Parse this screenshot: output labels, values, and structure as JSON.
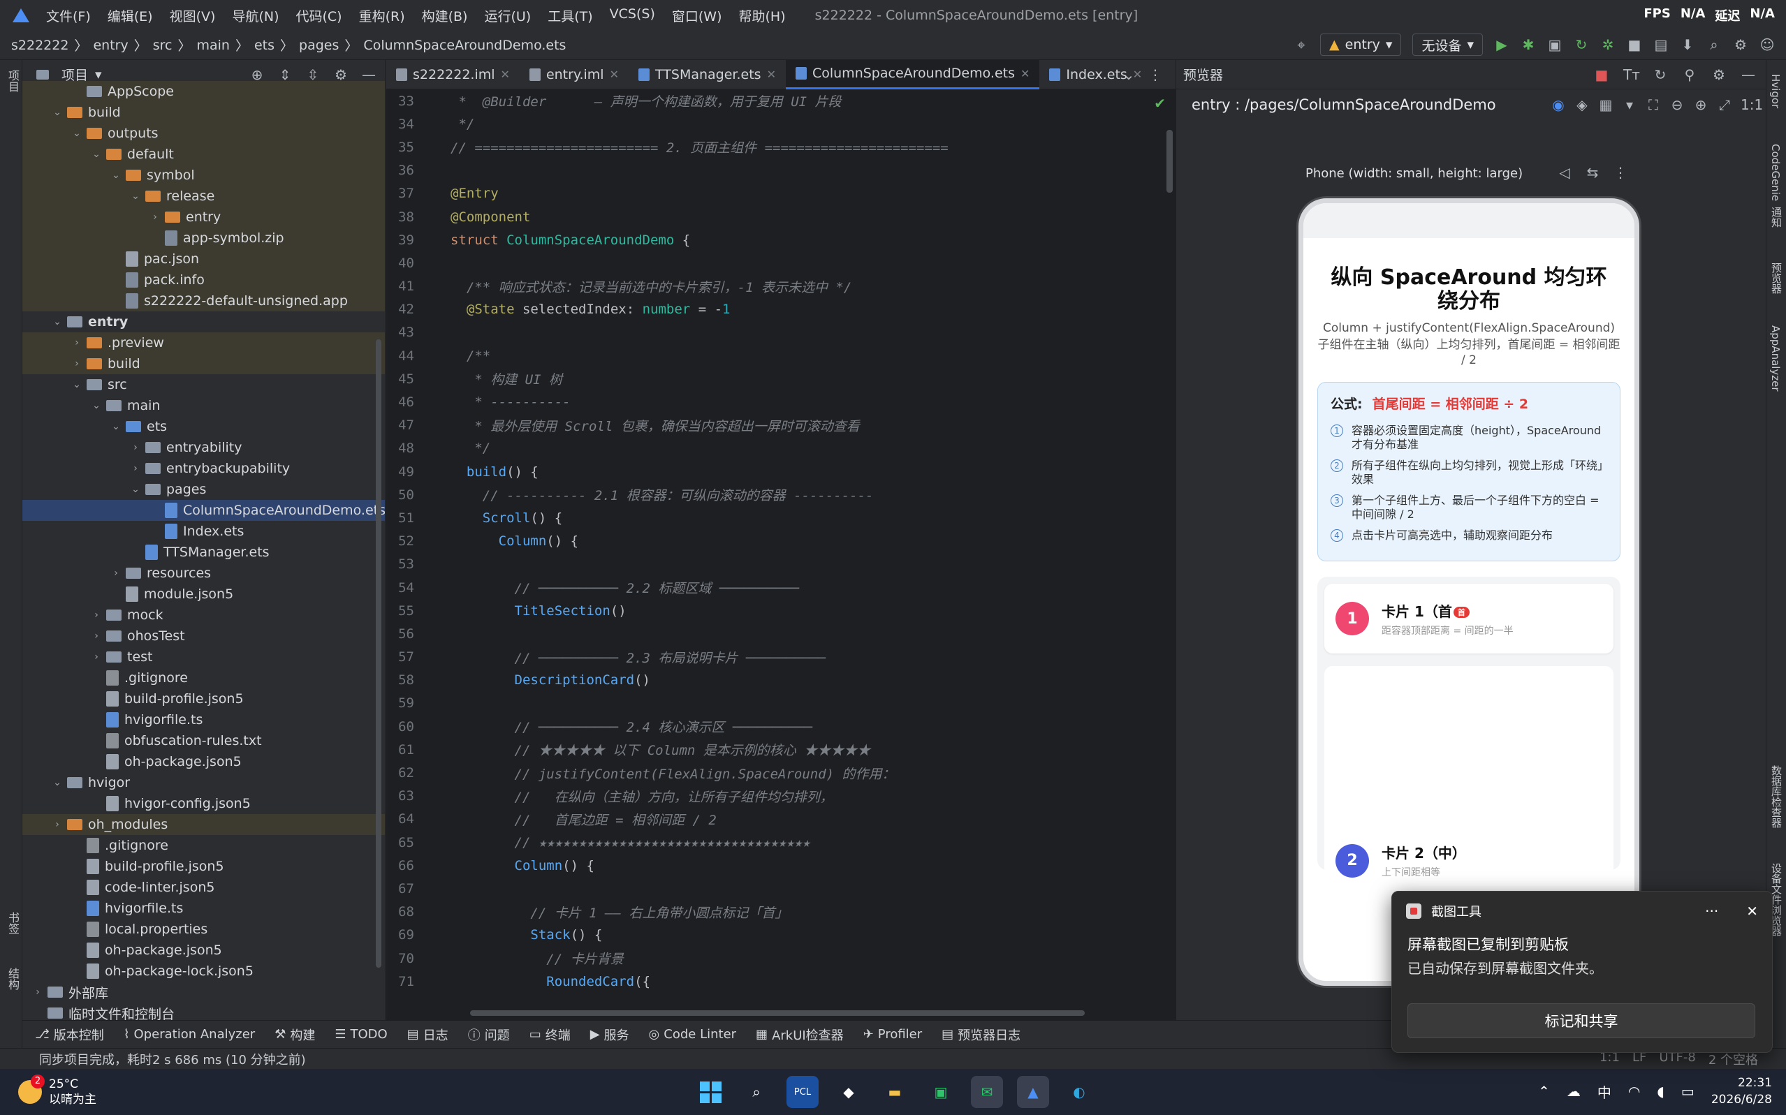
{
  "menubar": {
    "items": [
      "文件(F)",
      "编辑(E)",
      "视图(V)",
      "导航(N)",
      "代码(C)",
      "重构(R)",
      "构建(B)",
      "运行(U)",
      "工具(T)",
      "VCS(S)",
      "窗口(W)",
      "帮助(H)"
    ],
    "window_title": "s222222 - ColumnSpaceAroundDemo.ets [entry]",
    "fps_label": "FPS",
    "fps_value": "N/A",
    "delay_label": "延迟",
    "delay_value": "N/A"
  },
  "breadcrumb": [
    "s222222",
    "entry",
    "src",
    "main",
    "ets",
    "pages",
    "ColumnSpaceAroundDemo.ets"
  ],
  "run": {
    "module": "entry",
    "device": "无设备"
  },
  "leftstrip": {
    "project": "项目",
    "bookmarks": "书签",
    "structure": "结构"
  },
  "project": {
    "title": "项目",
    "tree": [
      {
        "d": 2,
        "t": "AppScope",
        "k": "fold",
        "a": "",
        "s": "ex"
      },
      {
        "d": 1,
        "t": "build",
        "k": "fold or",
        "a": "v",
        "s": "ex"
      },
      {
        "d": 2,
        "t": "outputs",
        "k": "fold or",
        "a": "v",
        "s": "ex"
      },
      {
        "d": 3,
        "t": "default",
        "k": "fold or",
        "a": "v",
        "s": "ex"
      },
      {
        "d": 4,
        "t": "symbol",
        "k": "fold or",
        "a": "v",
        "s": "ex"
      },
      {
        "d": 5,
        "t": "release",
        "k": "fold or",
        "a": "v",
        "s": "ex"
      },
      {
        "d": 6,
        "t": "entry",
        "k": "fold or",
        "a": ">",
        "s": "ex"
      },
      {
        "d": 6,
        "t": "app-symbol.zip",
        "k": "file",
        "a": "",
        "s": "ex"
      },
      {
        "d": 4,
        "t": "pac.json",
        "k": "file json",
        "a": "",
        "s": "ex"
      },
      {
        "d": 4,
        "t": "pack.info",
        "k": "file",
        "a": "",
        "s": "ex"
      },
      {
        "d": 4,
        "t": "s222222-default-unsigned.app",
        "k": "file",
        "a": "",
        "s": "ex"
      },
      {
        "d": 1,
        "t": "entry",
        "k": "fold",
        "a": "v",
        "s": "",
        "b": true
      },
      {
        "d": 2,
        "t": ".preview",
        "k": "fold or",
        "a": ">",
        "s": "ex"
      },
      {
        "d": 2,
        "t": "build",
        "k": "fold or",
        "a": ">",
        "s": "ex"
      },
      {
        "d": 2,
        "t": "src",
        "k": "fold",
        "a": "v",
        "s": ""
      },
      {
        "d": 3,
        "t": "main",
        "k": "fold",
        "a": "v",
        "s": ""
      },
      {
        "d": 4,
        "t": "ets",
        "k": "fold bl",
        "a": "v",
        "s": ""
      },
      {
        "d": 5,
        "t": "entryability",
        "k": "fold",
        "a": ">",
        "s": ""
      },
      {
        "d": 5,
        "t": "entrybackupability",
        "k": "fold",
        "a": ">",
        "s": ""
      },
      {
        "d": 5,
        "t": "pages",
        "k": "fold",
        "a": "v",
        "s": ""
      },
      {
        "d": 6,
        "t": "ColumnSpaceAroundDemo.ets",
        "k": "file ets",
        "a": "",
        "s": "sel"
      },
      {
        "d": 6,
        "t": "Index.ets",
        "k": "file ets",
        "a": "",
        "s": ""
      },
      {
        "d": 5,
        "t": "TTSManager.ets",
        "k": "file ets",
        "a": "",
        "s": ""
      },
      {
        "d": 4,
        "t": "resources",
        "k": "fold",
        "a": ">",
        "s": ""
      },
      {
        "d": 4,
        "t": "module.json5",
        "k": "file json",
        "a": "",
        "s": ""
      },
      {
        "d": 3,
        "t": "mock",
        "k": "fold",
        "a": ">",
        "s": ""
      },
      {
        "d": 3,
        "t": "ohosTest",
        "k": "fold",
        "a": ">",
        "s": ""
      },
      {
        "d": 3,
        "t": "test",
        "k": "fold",
        "a": ">",
        "s": ""
      },
      {
        "d": 3,
        "t": ".gitignore",
        "k": "file txt",
        "a": "",
        "s": ""
      },
      {
        "d": 3,
        "t": "build-profile.json5",
        "k": "file json",
        "a": "",
        "s": ""
      },
      {
        "d": 3,
        "t": "hvigorfile.ts",
        "k": "file ets",
        "a": "",
        "s": ""
      },
      {
        "d": 3,
        "t": "obfuscation-rules.txt",
        "k": "file txt",
        "a": "",
        "s": ""
      },
      {
        "d": 3,
        "t": "oh-package.json5",
        "k": "file json",
        "a": "",
        "s": ""
      },
      {
        "d": 1,
        "t": "hvigor",
        "k": "fold",
        "a": "v",
        "s": ""
      },
      {
        "d": 3,
        "t": "hvigor-config.json5",
        "k": "file json",
        "a": "",
        "s": ""
      },
      {
        "d": 1,
        "t": "oh_modules",
        "k": "fold or",
        "a": ">",
        "s": "ex"
      },
      {
        "d": 2,
        "t": ".gitignore",
        "k": "file txt",
        "a": "",
        "s": ""
      },
      {
        "d": 2,
        "t": "build-profile.json5",
        "k": "file json",
        "a": "",
        "s": ""
      },
      {
        "d": 2,
        "t": "code-linter.json5",
        "k": "file json",
        "a": "",
        "s": ""
      },
      {
        "d": 2,
        "t": "hvigorfile.ts",
        "k": "file ets",
        "a": "",
        "s": ""
      },
      {
        "d": 2,
        "t": "local.properties",
        "k": "file txt",
        "a": "",
        "s": ""
      },
      {
        "d": 2,
        "t": "oh-package.json5",
        "k": "file json",
        "a": "",
        "s": ""
      },
      {
        "d": 2,
        "t": "oh-package-lock.json5",
        "k": "file json",
        "a": "",
        "s": ""
      },
      {
        "d": 0,
        "t": "外部库",
        "k": "fold",
        "a": ">",
        "s": ""
      },
      {
        "d": 0,
        "t": "临时文件和控制台",
        "k": "fold",
        "a": "",
        "s": ""
      }
    ]
  },
  "editor": {
    "tabs": [
      {
        "label": "s222222.iml",
        "active": false
      },
      {
        "label": "entry.iml",
        "active": false
      },
      {
        "label": "TTSManager.ets",
        "active": false
      },
      {
        "label": "ColumnSpaceAroundDemo.ets",
        "active": true
      },
      {
        "label": "Index.ets",
        "active": false
      }
    ],
    "lines": [
      {
        "n": "33",
        "h": "<span class=\"cmt\"> *  @Builder      — 声明一个构建函数，用于复用 UI 片段</span>"
      },
      {
        "n": "34",
        "h": "<span class=\"cmt\"> */</span>"
      },
      {
        "n": "35",
        "h": "<span class=\"cmt\">// ======================= 2. 页面主组件 =======================</span>"
      },
      {
        "n": "36",
        "h": ""
      },
      {
        "n": "37",
        "h": "<span class=\"an\">@Entry</span>"
      },
      {
        "n": "38",
        "h": "<span class=\"an\">@Component</span>"
      },
      {
        "n": "39",
        "h": "<span class=\"kw\">struct</span> <span class=\"ty\">ColumnSpaceAroundDemo</span> <span class=\"tx\">{</span>"
      },
      {
        "n": "40",
        "h": ""
      },
      {
        "n": "41",
        "h": "  <span class=\"cmt\">/** 响应式状态：记录当前选中的卡片索引，-1 表示未选中 */</span>"
      },
      {
        "n": "42",
        "h": "  <span class=\"an\">@State</span> <span class=\"tx\">selectedIndex:</span> <span class=\"ty\">number</span> <span class=\"tx\">= -</span><span class=\"nm\">1</span>"
      },
      {
        "n": "43",
        "h": ""
      },
      {
        "n": "44",
        "h": "  <span class=\"cmt\">/**</span>"
      },
      {
        "n": "45",
        "h": "  <span class=\"cmt\"> * 构建 UI 树</span>"
      },
      {
        "n": "46",
        "h": "  <span class=\"cmt\"> * ----------</span>"
      },
      {
        "n": "47",
        "h": "  <span class=\"cmt\"> * 最外层使用 Scroll 包裹，确保当内容超出一屏时可滚动查看</span>"
      },
      {
        "n": "48",
        "h": "  <span class=\"cmt\"> */</span>"
      },
      {
        "n": "49",
        "h": "  <span class=\"fn\">build</span><span class=\"tx\">() {</span>"
      },
      {
        "n": "50",
        "h": "    <span class=\"cmt\">// ---------- 2.1 根容器：可纵向滚动的容器 ----------</span>"
      },
      {
        "n": "51",
        "h": "    <span class=\"fn\">Scroll</span><span class=\"tx\">() {</span>"
      },
      {
        "n": "52",
        "h": "      <span class=\"fn\">Column</span><span class=\"tx\">() {</span>"
      },
      {
        "n": "53",
        "h": ""
      },
      {
        "n": "54",
        "h": "        <span class=\"cmt\">// ────────── 2.2 标题区域 ──────────</span>"
      },
      {
        "n": "55",
        "h": "        <span class=\"fn\">TitleSection</span><span class=\"tx\">()</span>"
      },
      {
        "n": "56",
        "h": ""
      },
      {
        "n": "57",
        "h": "        <span class=\"cmt\">// ────────── 2.3 布局说明卡片 ──────────</span>"
      },
      {
        "n": "58",
        "h": "        <span class=\"fn\">DescriptionCard</span><span class=\"tx\">()</span>"
      },
      {
        "n": "59",
        "h": ""
      },
      {
        "n": "60",
        "h": "        <span class=\"cmt\">// ────────── 2.4 核心演示区 ──────────</span>"
      },
      {
        "n": "61",
        "h": "        <span class=\"cmt\">// ★★★★★ 以下 Column 是本示例的核心 ★★★★★</span>"
      },
      {
        "n": "62",
        "h": "        <span class=\"cmt\">// justifyContent(FlexAlign.SpaceAround) 的作用：</span>"
      },
      {
        "n": "63",
        "h": "        <span class=\"cmt\">//   在纵向（主轴）方向，让所有子组件均匀排列，</span>"
      },
      {
        "n": "64",
        "h": "        <span class=\"cmt\">//   首尾边距 = 相邻间距 / 2</span>"
      },
      {
        "n": "65",
        "h": "        <span class=\"cmt\">// ★★★★★★★★★★★★★★★★★★★★★★★★★★★★★★★★★★</span>"
      },
      {
        "n": "66",
        "h": "        <span class=\"fn\">Column</span><span class=\"tx\">() {</span>"
      },
      {
        "n": "67",
        "h": ""
      },
      {
        "n": "68",
        "h": "          <span class=\"cmt\">// 卡片 1 —— 右上角带小圆点标记「首」</span>"
      },
      {
        "n": "69",
        "h": "          <span class=\"fn\">Stack</span><span class=\"tx\">() {</span>"
      },
      {
        "n": "70",
        "h": "            <span class=\"cmt\">// 卡片背景</span>"
      },
      {
        "n": "71",
        "h": "            <span class=\"fn\">RoundedCard</span><span class=\"tx\">({</span>"
      }
    ]
  },
  "preview": {
    "title": "预览器",
    "path": "entry : /pages/ColumnSpaceAroundDemo",
    "device_label": "Phone (width: small, height: large)",
    "app": {
      "title": "纵向 SpaceAround 均匀环绕分布",
      "sub1": "Column + justifyContent(FlexAlign.SpaceAround)",
      "sub2": "子组件在主轴（纵向）上均匀排列，首尾间距 = 相邻间距 / 2",
      "formula_label": "公式:",
      "formula": "首尾间距 = 相邻间距 ÷ 2",
      "notes": [
        {
          "n": "1",
          "t": "容器必须设置固定高度（height），SpaceAround 才有分布基准"
        },
        {
          "n": "2",
          "t": "所有子组件在纵向上均匀排列，视觉上形成「环绕」效果"
        },
        {
          "n": "3",
          "t": "第一个子组件上方、最后一个子组件下方的空白 = 中间间隙 / 2"
        },
        {
          "n": "4",
          "t": "点击卡片可高亮选中，辅助观察间距分布"
        }
      ],
      "card1_num": "1",
      "card1_title": "卡片 1（首",
      "card1_badge": "首",
      "card1_sub": "距容器顶部距离 = 间距的一半",
      "card1_color": "#ef476f",
      "card2_num": "2",
      "card2_title": "卡片 2（中）",
      "card2_sub": "上下间距相等",
      "card2_color": "#4a5bdc"
    }
  },
  "rightstrip": [
    "Hvigor",
    "CodeGenie",
    "通知",
    "预览器",
    "AppAnalyzer",
    "数据库检查器",
    "设备文件浏览器"
  ],
  "bottom_tools": [
    "版本控制",
    "Operation Analyzer",
    "构建",
    "TODO",
    "日志",
    "问题",
    "终端",
    "服务",
    "Code Linter",
    "ArkUI检查器",
    "Profiler",
    "预览器日志"
  ],
  "status": {
    "msg": "同步项目完成，耗时2 s 686 ms (10 分钟之前)",
    "pos": "1:1",
    "lf": "LF",
    "enc": "UTF-8",
    "indent": "2 个空格"
  },
  "toast": {
    "app": "截图工具",
    "more": "···",
    "close": "✕",
    "line1": "屏幕截图已复制到剪贴板",
    "line2": "已自动保存到屏幕截图文件夹。",
    "button": "标记和共享"
  },
  "taskbar": {
    "temp": "25°C",
    "weather": "以晴为主",
    "badge": "2",
    "time": "22:31",
    "date": "2026/6/28",
    "ime": "中"
  }
}
